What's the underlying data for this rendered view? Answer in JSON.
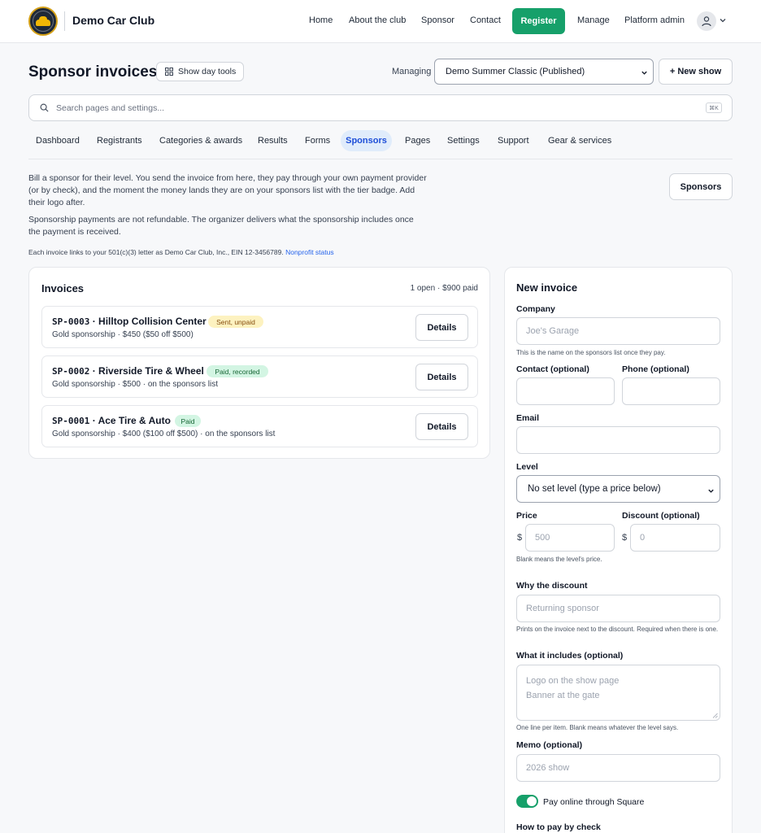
{
  "header": {
    "brand": "Demo Car Club",
    "nav": [
      "Home",
      "About the club",
      "Sponsor",
      "Contact",
      "Register",
      "Manage",
      "Platform admin"
    ],
    "accent_color": "#16a06a"
  },
  "toolbar": {
    "title": "Sponsor invoices",
    "day_tools_label": "Show day tools",
    "managing_label": "Managing",
    "managing_value": "Demo Summer Classic (Published)",
    "new_show_label": "+ New show"
  },
  "search": {
    "placeholder": "Search pages and settings...",
    "shortcut": "⌘K"
  },
  "tabs": [
    "Dashboard",
    "Registrants",
    "Categories & awards",
    "Results",
    "Forms",
    "Sponsors",
    "Pages",
    "Settings",
    "Support",
    "Gear & services"
  ],
  "active_tab": "Sponsors",
  "intro": {
    "paragraph1": "Bill a sponsor for their level. You send the invoice from here, they pay through your own payment provider (or by check), and the moment the money lands they are on your sponsors list with the tier badge. Add their logo after.",
    "paragraph2": "Sponsorship payments are not refundable. The organizer delivers what the sponsorship includes once the payment is received.",
    "note": "Each invoice links to your 501(c)(3) letter as Demo Car Club, Inc., EIN 12-3456789.",
    "note_link": "Nonprofit status",
    "sponsors_button": "Sponsors"
  },
  "invoices": {
    "title": "Invoices",
    "summary": "1 open · $900 paid",
    "details_label": "Details",
    "items": [
      {
        "number": "SP-0003",
        "company": "Hilltop Collision Center",
        "status": "Sent, unpaid",
        "status_color": "#fdf2c0",
        "detail": "Gold sponsorship · $450 ($50 off $500)"
      },
      {
        "number": "SP-0002",
        "company": "Riverside Tire & Wheel",
        "status": "Paid, recorded",
        "status_color": "#d3f5e3",
        "detail": "Gold sponsorship · $500 · on the sponsors list"
      },
      {
        "number": "SP-0001",
        "company": "Ace Tire & Auto",
        "status": "Paid",
        "status_color": "#d3f5e3",
        "detail": "Gold sponsorship · $400 ($100 off $500) · on the sponsors list"
      }
    ]
  },
  "new_invoice": {
    "title": "New invoice",
    "company_label": "Company",
    "company_placeholder": "Joe's Garage",
    "company_help": "This is the name on the sponsors list once they pay.",
    "contact_label": "Contact (optional)",
    "phone_label": "Phone (optional)",
    "email_label": "Email",
    "level_label": "Level",
    "level_value": "No set level (type a price below)",
    "price_label": "Price",
    "price_currency": "$",
    "price_placeholder": "500",
    "price_help": "Blank means the level's price.",
    "discount_label": "Discount (optional)",
    "discount_currency": "$",
    "discount_placeholder": "0",
    "why_label": "Why the discount",
    "why_placeholder": "Returning sponsor",
    "why_help": "Prints on the invoice next to the discount. Required when there is one.",
    "includes_label": "What it includes (optional)",
    "includes_placeholder_1": "Logo on the show page",
    "includes_placeholder_2": "Banner at the gate",
    "includes_help": "One line per item. Blank means whatever the level says.",
    "memo_label": "Memo (optional)",
    "memo_placeholder": "2026 show",
    "pay_online_label": "Pay online through Square",
    "pay_online_on": true,
    "check_label": "How to pay by check"
  }
}
